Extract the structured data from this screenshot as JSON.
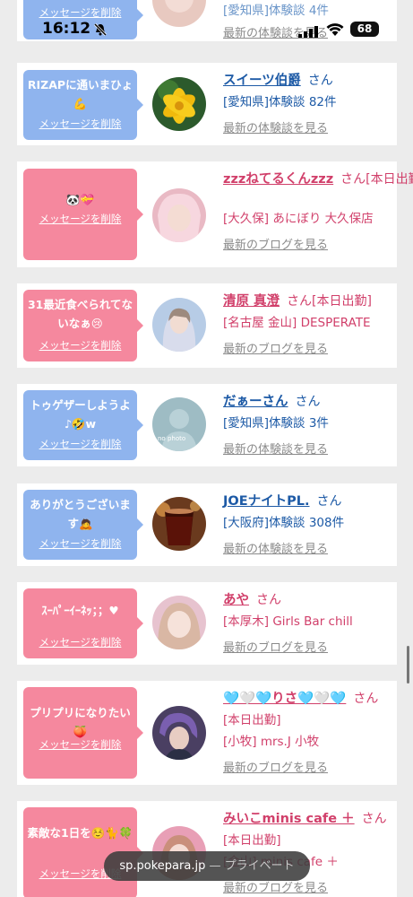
{
  "status_bar": {
    "time": "16:12",
    "battery": "68"
  },
  "url_bar": {
    "domain": "sp.pokepara.jp",
    "separator": " — ",
    "mode": "プライベート"
  },
  "top_partial": {
    "delete_label": "メッセージを削除",
    "line1": "[愛知県]体験談 4件",
    "more_link": "最新の体験談を見る"
  },
  "cards": [
    {
      "bubble_color": "blue",
      "message": "RIZAPに通いまひょ💪",
      "delete_label": "メッセージを削除",
      "name": "スイーツ伯爵",
      "san": "さん",
      "line1": "[愛知県]体験談 82件",
      "line2": "",
      "more_link": "最新の体験談を見る",
      "avatar": "yellow-flower"
    },
    {
      "bubble_color": "pink",
      "message": "🐼💝",
      "delete_label": "メッセージを削除",
      "name": "zzzねてるくんzzz",
      "san": "さん[本日出勤]",
      "line1": "[大久保] あにぼり 大久保店",
      "line2": "",
      "more_link": "最新のブログを見る",
      "avatar": "girl-pink"
    },
    {
      "bubble_color": "pink",
      "message": "31最近食べられてないなぁ😢",
      "delete_label": "メッセージを削除",
      "name": "清原 真澄",
      "san": "さん[本日出勤]",
      "line1": "[名古屋 金山] DESPERATE",
      "line2": "",
      "more_link": "最新のブログを見る",
      "avatar": "girl-blue"
    },
    {
      "bubble_color": "blue",
      "message": "トゥゲザーしようよ♪🤣w",
      "delete_label": "メッセージを削除",
      "name": "だぁーさん",
      "san": "さん",
      "line1": "[愛知県]体験談 3件",
      "line2": "",
      "more_link": "最新の体験談を見る",
      "avatar": "no-photo",
      "avatar_text": "no photo"
    },
    {
      "bubble_color": "blue",
      "message": "ありがとうございます🙇",
      "delete_label": "メッセージを削除",
      "name": "JOEナイトPL.",
      "san": "さん",
      "line1": "[大阪府]体験談 308件",
      "line2": "",
      "more_link": "最新の体験談を見る",
      "avatar": "drink"
    },
    {
      "bubble_color": "pink",
      "message": "ｽｰﾊﾟｰｲｰﾈｯ；；♥",
      "delete_label": "メッセージを削除",
      "name": "あや",
      "san": "さん",
      "line1": "[本厚木] Girls Bar chill",
      "line2": "",
      "more_link": "最新のブログを見る",
      "avatar": "girl-light"
    },
    {
      "bubble_color": "pink",
      "message": "プリプリになりたい🍑",
      "delete_label": "メッセージを削除",
      "name": "🩵🤍🩵りさ🩵🤍🩵",
      "san": "さん",
      "line1": "[本日出勤]",
      "line2": "[小牧] mrs.J 小牧",
      "more_link": "最新のブログを見る",
      "avatar": "girl-purple"
    },
    {
      "bubble_color": "pink",
      "message": "素敵な1日を☺️🐈🍀",
      "delete_label": "メッセージを削除",
      "name": "みいこminis cafe ＋",
      "san": "さん",
      "line1": "[本日出勤]",
      "line2": "[金山] minis cafe ＋",
      "more_link": "最新のブログを見る",
      "avatar": "girl-pink2"
    }
  ]
}
